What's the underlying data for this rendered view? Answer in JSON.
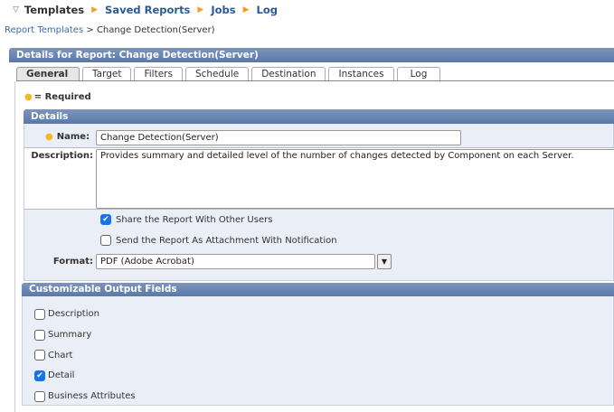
{
  "topnav": {
    "current": "Templates",
    "links": [
      "Saved Reports",
      "Jobs",
      "Log"
    ]
  },
  "breadcrumb": {
    "parent": "Report Templates",
    "separator": ">",
    "current": "Change Detection(Server)"
  },
  "header": {
    "title": "Details for Report: Change Detection(Server)"
  },
  "tabs": [
    "General",
    "Target",
    "Filters",
    "Schedule",
    "Destination",
    "Instances",
    "Log"
  ],
  "required_note": "= Required",
  "details": {
    "title": "Details",
    "name_label": "Name:",
    "name_value": "Change Detection(Server)",
    "description_label": "Description:",
    "description_value": "Provides summary and detailed level of the number of changes detected by Component on each Server.",
    "share_label": "Share the Report With Other Users",
    "share_checked": true,
    "attach_label": "Send the Report As Attachment With Notification",
    "attach_checked": false,
    "format_label": "Format:",
    "format_value": "PDF (Adobe Acrobat)"
  },
  "output_fields": {
    "title": "Customizable Output Fields",
    "items": [
      {
        "label": "Description",
        "checked": false
      },
      {
        "label": "Summary",
        "checked": false
      },
      {
        "label": "Chart",
        "checked": false
      },
      {
        "label": "Detail",
        "checked": true
      },
      {
        "label": "Business Attributes",
        "checked": false
      }
    ]
  }
}
